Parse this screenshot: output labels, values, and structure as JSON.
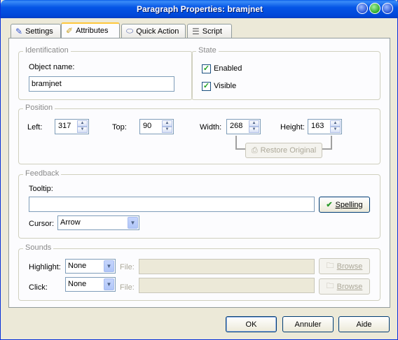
{
  "window": {
    "title": "Paragraph Properties: bramjnet"
  },
  "tabs": [
    {
      "label": "Settings",
      "icon": "brush-icon"
    },
    {
      "label": "Attributes",
      "icon": "pencil-icon"
    },
    {
      "label": "Quick Action",
      "icon": "disk-icon"
    },
    {
      "label": "Script",
      "icon": "script-icon"
    }
  ],
  "identification": {
    "legend": "Identification",
    "object_name_label": "Object name:",
    "object_name_value": "bramjnet"
  },
  "state": {
    "legend": "State",
    "enabled_label": "Enabled",
    "visible_label": "Visible",
    "enabled": true,
    "visible": true
  },
  "position": {
    "legend": "Position",
    "left_label": "Left:",
    "left_value": "317",
    "top_label": "Top:",
    "top_value": "90",
    "width_label": "Width:",
    "width_value": "268",
    "height_label": "Height:",
    "height_value": "163",
    "restore_label": "Restore Original"
  },
  "feedback": {
    "legend": "Feedback",
    "tooltip_label": "Tooltip:",
    "tooltip_value": "",
    "spelling_label": "Spelling",
    "cursor_label": "Cursor:",
    "cursor_value": "Arrow"
  },
  "sounds": {
    "legend": "Sounds",
    "highlight_label": "Highlight:",
    "highlight_value": "None",
    "click_label": "Click:",
    "click_value": "None",
    "file_label": "File:",
    "browse_label": "Browse"
  },
  "footer": {
    "ok_label": "OK",
    "cancel_label": "Annuler",
    "help_label": "Aide"
  },
  "colors": {
    "titlebar": "#0054e3",
    "face": "#ece9d8",
    "panel": "#fcfcfe",
    "tab_highlight": "#ffc83c"
  }
}
